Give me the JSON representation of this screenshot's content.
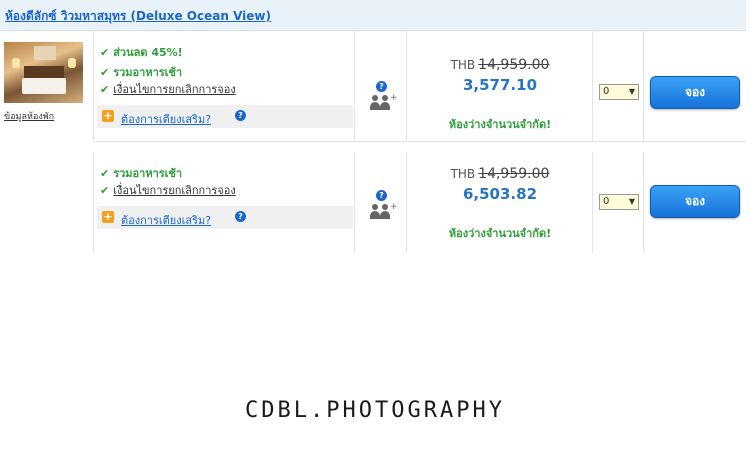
{
  "room": {
    "title": "ห้องดีลักซ์ วิวมหาสมุทร (Deluxe Ocean View)",
    "info_link": "ข้อมูลห้องพัก"
  },
  "offers": [
    {
      "discount": "ส่วนลด 45%!",
      "breakfast": "รวมอาหารเช้า",
      "cancellation": "เงื่อนไขการยกเลิกการจอง",
      "extra_bed": "ต้องการเตียงเสริม?",
      "currency": "THB",
      "original_price": "14,959.00",
      "price": "3,577.10",
      "availability": "ห้องว่างจำนวนจำกัด!",
      "quantity": "0",
      "book_label": "จอง"
    },
    {
      "breakfast": "รวมอาหารเช้า",
      "cancellation": "เงื่อนไขการยกเลิกการจอง",
      "extra_bed": "ต้องการเตียงเสริม?",
      "currency": "THB",
      "original_price": "14,959.00",
      "price": "6,503.82",
      "availability": "ห้องว่างจำนวนจำกัด!",
      "quantity": "0",
      "book_label": "จอง"
    }
  ],
  "icons": {
    "check": "✔",
    "plus": "+",
    "help": "?",
    "dropdown": "▼"
  },
  "colors": {
    "link": "#1a66c9",
    "price": "#2575c4",
    "green": "#2f9e3a",
    "button": "#1673d8"
  },
  "watermark": "CDBL.PHOTOGRAPHY"
}
